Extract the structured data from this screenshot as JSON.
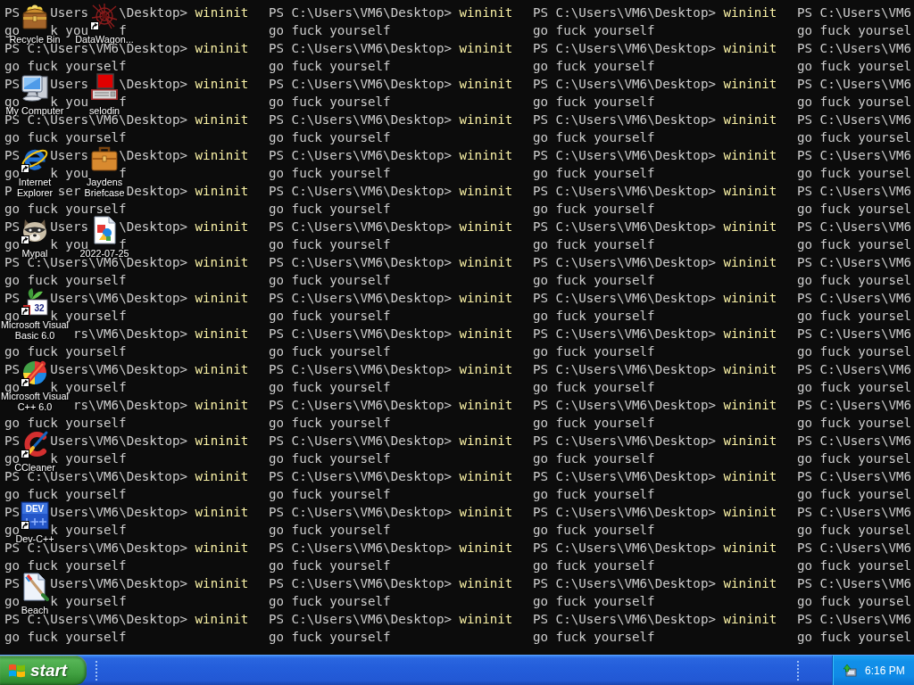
{
  "console": {
    "lines": [
      {
        "kind": "prompt",
        "cells": [
          {
            "prompt": "PS    Users    \\Desktop>",
            "command": "wininit"
          },
          {
            "prompt": "PS C:\\Users\\VM6\\Desktop>",
            "command": "wininit"
          },
          {
            "prompt": "PS C:\\Users\\VM6\\Desktop>",
            "command": "wininit"
          },
          {
            "prompt": "PS C:\\Users\\VM6"
          }
        ]
      },
      {
        "kind": "output",
        "cells": [
          {
            "text": "go    k you    f"
          },
          {
            "text": "go fuck yourself"
          },
          {
            "text": "go fuck yourself"
          },
          {
            "text": "go fuck yoursel"
          }
        ]
      },
      {
        "kind": "prompt",
        "cells": [
          {
            "prompt": "PS C:\\Users\\VM6\\Desktop>",
            "command": "wininit"
          },
          {
            "prompt": "PS C:\\Users\\VM6\\Desktop>",
            "command": "wininit"
          },
          {
            "prompt": "PS C:\\Users\\VM6\\Desktop>",
            "command": "wininit"
          },
          {
            "prompt": "PS C:\\Users\\VM6"
          }
        ]
      },
      {
        "kind": "output",
        "cells": [
          {
            "text": "go fuck yourself"
          },
          {
            "text": "go fuck yourself"
          },
          {
            "text": "go fuck yourself"
          },
          {
            "text": "go fuck yoursel"
          }
        ]
      },
      {
        "kind": "prompt",
        "cells": [
          {
            "prompt": "PS    Users    \\Desktop>",
            "command": "wininit"
          },
          {
            "prompt": "PS C:\\Users\\VM6\\Desktop>",
            "command": "wininit"
          },
          {
            "prompt": "PS C:\\Users\\VM6\\Desktop>",
            "command": "wininit"
          },
          {
            "prompt": "PS C:\\Users\\VM6"
          }
        ]
      },
      {
        "kind": "output",
        "cells": [
          {
            "text": "go    k you    f"
          },
          {
            "text": "go fuck yourself"
          },
          {
            "text": "go fuck yourself"
          },
          {
            "text": "go fuck yoursel"
          }
        ]
      },
      {
        "kind": "prompt",
        "cells": [
          {
            "prompt": "PS C:\\Users\\VM6\\Desktop>",
            "command": "wininit"
          },
          {
            "prompt": "PS C:\\Users\\VM6\\Desktop>",
            "command": "wininit"
          },
          {
            "prompt": "PS C:\\Users\\VM6\\Desktop>",
            "command": "wininit"
          },
          {
            "prompt": "PS C:\\Users\\VM6"
          }
        ]
      },
      {
        "kind": "output",
        "cells": [
          {
            "text": "go fuck yourself"
          },
          {
            "text": "go fuck yourself"
          },
          {
            "text": "go fuck yourself"
          },
          {
            "text": "go fuck yoursel"
          }
        ]
      },
      {
        "kind": "prompt",
        "cells": [
          {
            "prompt": "PS    Users    \\Desktop>",
            "command": "wininit"
          },
          {
            "prompt": "PS C:\\Users\\VM6\\Desktop>",
            "command": "wininit"
          },
          {
            "prompt": "PS C:\\Users\\VM6\\Desktop>",
            "command": "wininit"
          },
          {
            "prompt": "PS C:\\Users\\VM6"
          }
        ]
      },
      {
        "kind": "output",
        "cells": [
          {
            "text": "go    k you    f"
          },
          {
            "text": "go fuck yourself"
          },
          {
            "text": "go fuck yourself"
          },
          {
            "text": "go fuck yoursel"
          }
        ]
      },
      {
        "kind": "prompt",
        "cells": [
          {
            "prompt": "P      ser      Desktop>",
            "command": "wininit"
          },
          {
            "prompt": "PS C:\\Users\\VM6\\Desktop>",
            "command": "wininit"
          },
          {
            "prompt": "PS C:\\Users\\VM6\\Desktop>",
            "command": "wininit"
          },
          {
            "prompt": "PS C:\\Users\\VM6"
          }
        ]
      },
      {
        "kind": "output",
        "cells": [
          {
            "text": "go fuck yourself"
          },
          {
            "text": "go fuck yourself"
          },
          {
            "text": "go fuck yourself"
          },
          {
            "text": "go fuck yoursel"
          }
        ]
      },
      {
        "kind": "prompt",
        "cells": [
          {
            "prompt": "PS    Users    \\Desktop>",
            "command": "wininit"
          },
          {
            "prompt": "PS C:\\Users\\VM6\\Desktop>",
            "command": "wininit"
          },
          {
            "prompt": "PS C:\\Users\\VM6\\Desktop>",
            "command": "wininit"
          },
          {
            "prompt": "PS C:\\Users\\VM6"
          }
        ]
      },
      {
        "kind": "output",
        "cells": [
          {
            "text": "go    k you    f"
          },
          {
            "text": "go fuck yourself"
          },
          {
            "text": "go fuck yourself"
          },
          {
            "text": "go fuck yoursel"
          }
        ]
      },
      {
        "kind": "prompt",
        "cells": [
          {
            "prompt": "PS C:\\Users\\VM6\\Desktop>",
            "command": "wininit"
          },
          {
            "prompt": "PS C:\\Users\\VM6\\Desktop>",
            "command": "wininit"
          },
          {
            "prompt": "PS C:\\Users\\VM6\\Desktop>",
            "command": "wininit"
          },
          {
            "prompt": "PS C:\\Users\\VM6"
          }
        ]
      },
      {
        "kind": "output",
        "cells": [
          {
            "text": "go fuck yourself"
          },
          {
            "text": "go fuck yourself"
          },
          {
            "text": "go fuck yourself"
          },
          {
            "text": "go fuck yoursel"
          }
        ]
      },
      {
        "kind": "prompt",
        "cells": [
          {
            "prompt": "PS    Users\\VM6\\Desktop>",
            "command": "wininit"
          },
          {
            "prompt": "PS C:\\Users\\VM6\\Desktop>",
            "command": "wininit"
          },
          {
            "prompt": "PS C:\\Users\\VM6\\Desktop>",
            "command": "wininit"
          },
          {
            "prompt": "PS C:\\Users\\VM6"
          }
        ]
      },
      {
        "kind": "output",
        "cells": [
          {
            "text": "go    k yourself"
          },
          {
            "text": "go fuck yourself"
          },
          {
            "text": "go fuck yourself"
          },
          {
            "text": "go fuck yoursel"
          }
        ]
      },
      {
        "kind": "prompt",
        "cells": [
          {
            "prompt": "         rs\\VM6\\Desktop>",
            "command": "wininit"
          },
          {
            "prompt": "PS C:\\Users\\VM6\\Desktop>",
            "command": "wininit"
          },
          {
            "prompt": "PS C:\\Users\\VM6\\Desktop>",
            "command": "wininit"
          },
          {
            "prompt": "PS C:\\Users\\VM6"
          }
        ]
      },
      {
        "kind": "output",
        "cells": [
          {
            "text": "go fuck yourself"
          },
          {
            "text": "go fuck yourself"
          },
          {
            "text": "go fuck yourself"
          },
          {
            "text": "go fuck yoursel"
          }
        ]
      },
      {
        "kind": "prompt",
        "cells": [
          {
            "prompt": "PS    Users\\VM6\\Desktop>",
            "command": "wininit"
          },
          {
            "prompt": "PS C:\\Users\\VM6\\Desktop>",
            "command": "wininit"
          },
          {
            "prompt": "PS C:\\Users\\VM6\\Desktop>",
            "command": "wininit"
          },
          {
            "prompt": "PS C:\\Users\\VM6"
          }
        ]
      },
      {
        "kind": "output",
        "cells": [
          {
            "text": "go    k yourself"
          },
          {
            "text": "go fuck yourself"
          },
          {
            "text": "go fuck yourself"
          },
          {
            "text": "go fuck yoursel"
          }
        ]
      },
      {
        "kind": "prompt",
        "cells": [
          {
            "prompt": "         rs\\VM6\\Desktop>",
            "command": "wininit"
          },
          {
            "prompt": "PS C:\\Users\\VM6\\Desktop>",
            "command": "wininit"
          },
          {
            "prompt": "PS C:\\Users\\VM6\\Desktop>",
            "command": "wininit"
          },
          {
            "prompt": "PS C:\\Users\\VM6"
          }
        ]
      },
      {
        "kind": "output",
        "cells": [
          {
            "text": "go fuck yourself"
          },
          {
            "text": "go fuck yourself"
          },
          {
            "text": "go fuck yourself"
          },
          {
            "text": "go fuck yoursel"
          }
        ]
      },
      {
        "kind": "prompt",
        "cells": [
          {
            "prompt": "PS    Users\\VM6\\Desktop>",
            "command": "wininit"
          },
          {
            "prompt": "PS C:\\Users\\VM6\\Desktop>",
            "command": "wininit"
          },
          {
            "prompt": "PS C:\\Users\\VM6\\Desktop>",
            "command": "wininit"
          },
          {
            "prompt": "PS C:\\Users\\VM6"
          }
        ]
      },
      {
        "kind": "output",
        "cells": [
          {
            "text": "go    k yourself"
          },
          {
            "text": "go fuck yourself"
          },
          {
            "text": "go fuck yourself"
          },
          {
            "text": "go fuck yoursel"
          }
        ]
      },
      {
        "kind": "prompt",
        "cells": [
          {
            "prompt": "PS C:\\Users\\VM6\\Desktop>",
            "command": "wininit"
          },
          {
            "prompt": "PS C:\\Users\\VM6\\Desktop>",
            "command": "wininit"
          },
          {
            "prompt": "PS C:\\Users\\VM6\\Desktop>",
            "command": "wininit"
          },
          {
            "prompt": "PS C:\\Users\\VM6"
          }
        ]
      },
      {
        "kind": "output",
        "cells": [
          {
            "text": "go fuck yourself"
          },
          {
            "text": "go fuck yourself"
          },
          {
            "text": "go fuck yourself"
          },
          {
            "text": "go fuck yoursel"
          }
        ]
      },
      {
        "kind": "prompt",
        "cells": [
          {
            "prompt": "PS    Users\\VM6\\Desktop>",
            "command": "wininit"
          },
          {
            "prompt": "PS C:\\Users\\VM6\\Desktop>",
            "command": "wininit"
          },
          {
            "prompt": "PS C:\\Users\\VM6\\Desktop>",
            "command": "wininit"
          },
          {
            "prompt": "PS C:\\Users\\VM6"
          }
        ]
      },
      {
        "kind": "output",
        "cells": [
          {
            "text": "go    k yourself"
          },
          {
            "text": "go fuck yourself"
          },
          {
            "text": "go fuck yourself"
          },
          {
            "text": "go fuck yoursel"
          }
        ]
      },
      {
        "kind": "prompt",
        "cells": [
          {
            "prompt": "PS C:\\Users\\VM6\\Desktop>",
            "command": "wininit"
          },
          {
            "prompt": "PS C:\\Users\\VM6\\Desktop>",
            "command": "wininit"
          },
          {
            "prompt": "PS C:\\Users\\VM6\\Desktop>",
            "command": "wininit"
          },
          {
            "prompt": "PS C:\\Users\\VM6"
          }
        ]
      },
      {
        "kind": "output",
        "cells": [
          {
            "text": "go fuck yourself"
          },
          {
            "text": "go fuck yourself"
          },
          {
            "text": "go fuck yourself"
          },
          {
            "text": "go fuck yoursel"
          }
        ]
      },
      {
        "kind": "prompt",
        "cells": [
          {
            "prompt": "PS    Users\\VM6\\Desktop>",
            "command": "wininit"
          },
          {
            "prompt": "PS C:\\Users\\VM6\\Desktop>",
            "command": "wininit"
          },
          {
            "prompt": "PS C:\\Users\\VM6\\Desktop>",
            "command": "wininit"
          },
          {
            "prompt": "PS C:\\Users\\VM6"
          }
        ]
      },
      {
        "kind": "output",
        "cells": [
          {
            "text": "go    k yourself"
          },
          {
            "text": "go fuck yourself"
          },
          {
            "text": "go fuck yourself"
          },
          {
            "text": "go fuck yoursel"
          }
        ]
      },
      {
        "kind": "prompt",
        "cells": [
          {
            "prompt": "PS C:\\Users\\VM6\\Desktop>",
            "command": "wininit"
          },
          {
            "prompt": "PS C:\\Users\\VM6\\Desktop>",
            "command": "wininit"
          },
          {
            "prompt": "PS C:\\Users\\VM6\\Desktop>",
            "command": "wininit"
          },
          {
            "prompt": "PS C:\\Users\\VM6"
          }
        ]
      },
      {
        "kind": "output",
        "cells": [
          {
            "text": "go fuck yourself"
          },
          {
            "text": "go fuck yourself"
          },
          {
            "text": "go fuck yourself"
          },
          {
            "text": "go fuck yoursel"
          }
        ]
      }
    ]
  },
  "desktop": {
    "icon_columns": [
      {
        "icons": [
          {
            "kind": "chest",
            "label": "Recycle Bin",
            "shortcut": false
          },
          {
            "kind": "computer",
            "label": "My Computer",
            "shortcut": false
          },
          {
            "kind": "ie",
            "label": "Internet Explorer",
            "shortcut": true
          },
          {
            "kind": "raccoon",
            "label": "Mypal",
            "shortcut": true
          },
          {
            "kind": "vb",
            "label": "Microsoft Visual Basic 6.0",
            "shortcut": true,
            "badge": "32"
          },
          {
            "kind": "wheel",
            "label": "Microsoft Visual C++ 6.0",
            "shortcut": true
          },
          {
            "kind": "red-c",
            "label": "CCleaner",
            "shortcut": true
          },
          {
            "kind": "dev",
            "label": "Dev-C++",
            "shortcut": true,
            "badge": "DEV"
          },
          {
            "kind": "paint-doc",
            "label": "Beach",
            "shortcut": false
          }
        ]
      },
      {
        "icons": [
          {
            "kind": "splash",
            "label": "DataWagon...",
            "shortcut": true
          },
          {
            "kind": "terminal",
            "label": "selodin",
            "shortcut": false
          },
          {
            "kind": "briefcase",
            "label": "Jaydens Briefcase",
            "shortcut": false
          },
          {
            "kind": "image-file",
            "label": "2022-07-25",
            "shortcut": false
          }
        ]
      }
    ]
  },
  "taskbar": {
    "start_button": {
      "label": "start"
    },
    "tray": {
      "clock": "6:16 PM"
    }
  }
}
